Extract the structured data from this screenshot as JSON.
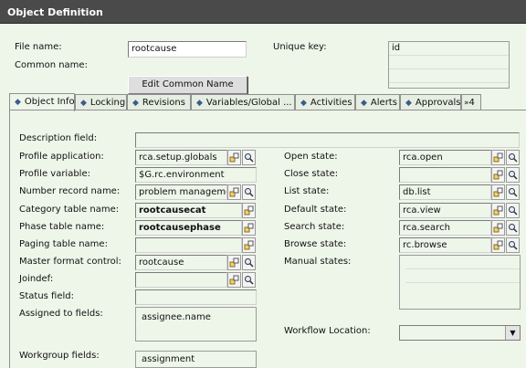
{
  "window": {
    "title": "Object Definition"
  },
  "header": {
    "file_name_label": "File name:",
    "file_name_value": "rootcause",
    "common_name_label": "Common name:",
    "unique_key_label": "Unique key:",
    "unique_key_values": [
      "id",
      "",
      "",
      ""
    ],
    "edit_common_name_label": "Edit Common Name"
  },
  "tabs": [
    {
      "label": "Object Info",
      "active": true
    },
    {
      "label": "Locking"
    },
    {
      "label": "Revisions"
    },
    {
      "label": "Variables/Global ..."
    },
    {
      "label": "Activities"
    },
    {
      "label": "Alerts"
    },
    {
      "label": "Approvals"
    },
    {
      "label": "4",
      "overflow": true
    }
  ],
  "object_info": {
    "description_field": {
      "label": "Description field:",
      "value": ""
    },
    "profile_application": {
      "label": "Profile application:",
      "value": "rca.setup.globals"
    },
    "profile_variable": {
      "label": "Profile variable:",
      "value": "$G.rc.environment"
    },
    "number_record_name": {
      "label": "Number record name:",
      "value": "problem management"
    },
    "category_table_name": {
      "label": "Category table name:",
      "value": "rootcausecat"
    },
    "phase_table_name": {
      "label": "Phase table name:",
      "value": "rootcausephase"
    },
    "paging_table_name": {
      "label": "Paging table name:",
      "value": ""
    },
    "master_format_control": {
      "label": "Master format control:",
      "value": "rootcause"
    },
    "joindef": {
      "label": "Joindef:",
      "value": ""
    },
    "status_field": {
      "label": "Status field:",
      "value": ""
    },
    "assigned_to_fields": {
      "label": "Assigned to fields:",
      "values": [
        "assignee.name"
      ]
    },
    "workgroup_fields": {
      "label": "Workgroup fields:",
      "values": [
        "assignment"
      ]
    },
    "open_state": {
      "label": "Open state:",
      "value": "rca.open"
    },
    "close_state": {
      "label": "Close state:",
      "value": ""
    },
    "list_state": {
      "label": "List state:",
      "value": "db.list"
    },
    "default_state": {
      "label": "Default state:",
      "value": "rca.view"
    },
    "search_state": {
      "label": "Search state:",
      "value": "rca.search"
    },
    "browse_state": {
      "label": "Browse state:",
      "value": "rc.browse"
    },
    "manual_states": {
      "label": "Manual states:"
    },
    "workflow_location": {
      "label": "Workflow Location:",
      "value": ""
    }
  },
  "icons": {
    "link": "link-record-icon",
    "search": "magnifier-icon",
    "tab": "diamond-icon"
  }
}
